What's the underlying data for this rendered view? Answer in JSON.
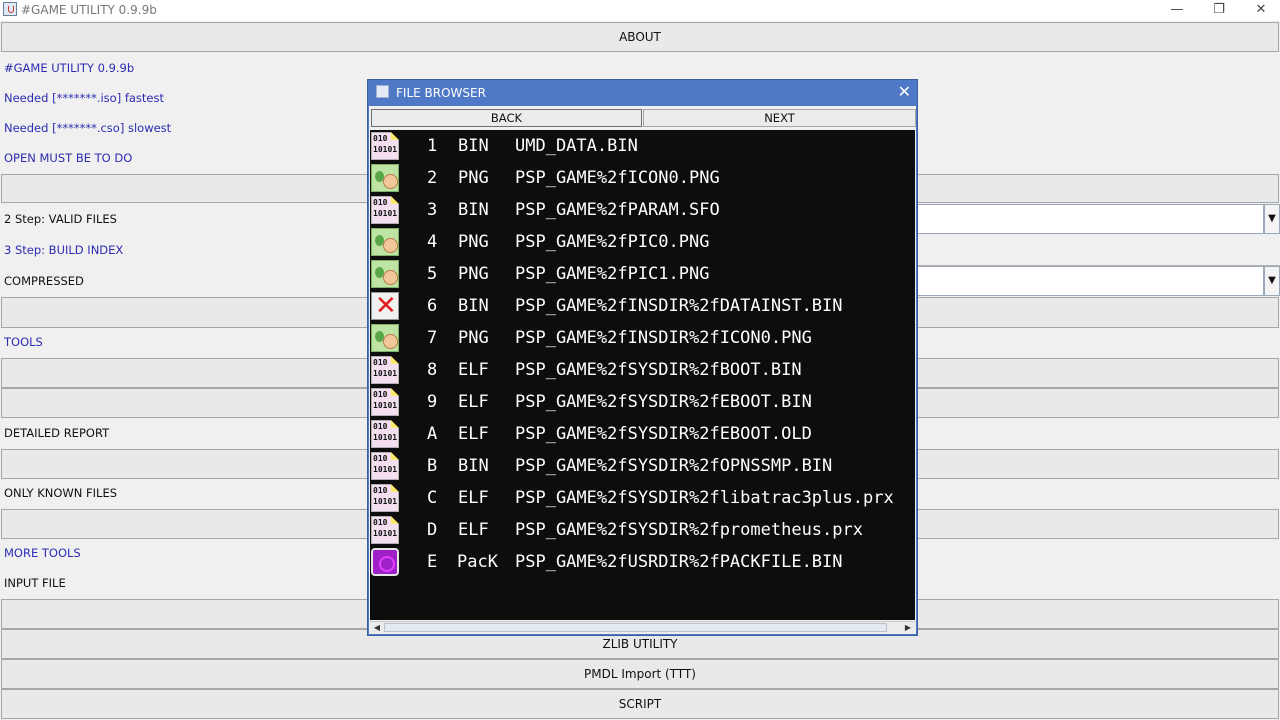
{
  "window": {
    "title": "#GAME UTILITY 0.9.9b",
    "minimize": "—",
    "maximize": "❐",
    "close": "✕"
  },
  "main": {
    "about": "ABOUT",
    "labels": {
      "version": "#GAME UTILITY 0.9.9b",
      "iso": "Needed [*******.iso] fastest",
      "cso": "Needed [*******.cso] slowest",
      "open": "OPEN MUST BE TO DO",
      "step2": "2 Step: VALID FILES",
      "step3": "3 Step: BUILD INDEX",
      "compressed": "COMPRESSED",
      "tools": "TOOLS",
      "detailed": "DETAILED REPORT",
      "only_known": "ONLY KNOWN FILES",
      "more_tools": "MORE TOOLS",
      "input_file": "INPUT FILE"
    },
    "zlib": "ZLIB UTILITY",
    "pmdl": "PMDL Import (TTT)",
    "script": "SCRIPT"
  },
  "dialog": {
    "title": "FILE BROWSER",
    "close": "✕",
    "back": "BACK",
    "next": "NEXT",
    "files": [
      {
        "index": "1",
        "type": "BIN",
        "name": "UMD_DATA.BIN",
        "icon": "binary-file-icon"
      },
      {
        "index": "2",
        "type": "PNG",
        "name": "PSP_GAME%2fICON0.PNG",
        "icon": "image-file-icon"
      },
      {
        "index": "3",
        "type": "BIN",
        "name": "PSP_GAME%2fPARAM.SFO",
        "icon": "binary-file-icon"
      },
      {
        "index": "4",
        "type": "PNG",
        "name": "PSP_GAME%2fPIC0.PNG",
        "icon": "image-file-icon"
      },
      {
        "index": "5",
        "type": "PNG",
        "name": "PSP_GAME%2fPIC1.PNG",
        "icon": "image-file-icon"
      },
      {
        "index": "6",
        "type": "BIN",
        "name": "PSP_GAME%2fINSDIR%2fDATAINST.BIN",
        "icon": "error-file-icon"
      },
      {
        "index": "7",
        "type": "PNG",
        "name": "PSP_GAME%2fINSDIR%2fICON0.PNG",
        "icon": "image-file-icon"
      },
      {
        "index": "8",
        "type": "ELF",
        "name": "PSP_GAME%2fSYSDIR%2fBOOT.BIN",
        "icon": "binary-file-icon"
      },
      {
        "index": "9",
        "type": "ELF",
        "name": "PSP_GAME%2fSYSDIR%2fEBOOT.BIN",
        "icon": "binary-file-icon"
      },
      {
        "index": "A",
        "type": "ELF",
        "name": "PSP_GAME%2fSYSDIR%2fEBOOT.OLD",
        "icon": "binary-file-icon"
      },
      {
        "index": "B",
        "type": "BIN",
        "name": "PSP_GAME%2fSYSDIR%2fOPNSSMP.BIN",
        "icon": "binary-file-icon"
      },
      {
        "index": "C",
        "type": "ELF",
        "name": "PSP_GAME%2fSYSDIR%2flibatrac3plus.prx",
        "icon": "binary-file-icon"
      },
      {
        "index": "D",
        "type": "ELF",
        "name": "PSP_GAME%2fSYSDIR%2fprometheus.prx",
        "icon": "binary-file-icon"
      },
      {
        "index": "E",
        "type": "PacK",
        "name": "PSP_GAME%2fUSRDIR%2fPACKFILE.BIN",
        "icon": "pack-file-icon"
      }
    ],
    "bin_icon_text": "010\n10101"
  }
}
